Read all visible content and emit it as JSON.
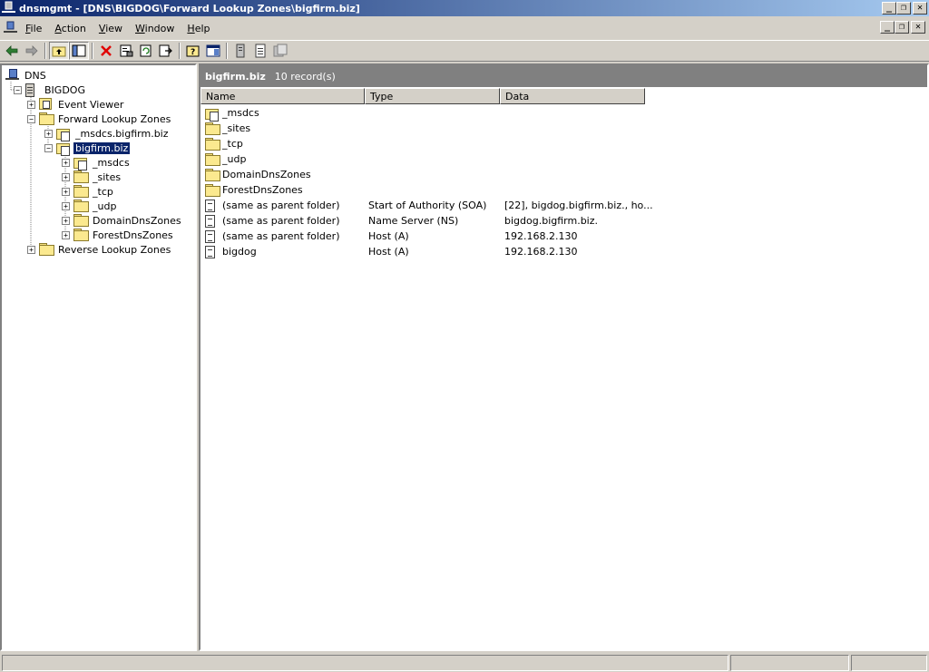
{
  "window": {
    "title": "dnsmgmt - [DNS\\BIGDOG\\Forward Lookup Zones\\bigfirm.biz]",
    "controls": {
      "minimize": "_",
      "restore": "❐",
      "close": "✕"
    }
  },
  "menu": {
    "items": [
      {
        "label": "File",
        "key": "F",
        "rest": "ile"
      },
      {
        "label": "Action",
        "key": "A",
        "rest": "ction"
      },
      {
        "label": "View",
        "key": "V",
        "rest": "iew"
      },
      {
        "label": "Window",
        "key": "W",
        "rest": "indow"
      },
      {
        "label": "Help",
        "key": "H",
        "rest": "elp"
      }
    ]
  },
  "toolbar": {
    "icons": [
      "back-icon",
      "forward-icon",
      "up-icon",
      "show-hide-tree-icon",
      "delete-icon",
      "properties-icon",
      "refresh-icon",
      "export-icon",
      "help-icon",
      "action-pane-icon",
      "server-icon",
      "record-icon",
      "zone-icon"
    ]
  },
  "tree": {
    "items": [
      {
        "label": "DNS",
        "icon": "dns-icon",
        "expander": "",
        "level": 0
      },
      {
        "label": "BIGDOG",
        "icon": "server-icon",
        "expander": "−",
        "level": 1
      },
      {
        "label": "Event Viewer",
        "icon": "event-viewer-icon",
        "expander": "+",
        "level": 2
      },
      {
        "label": "Forward Lookup Zones",
        "icon": "folder-icon",
        "expander": "−",
        "level": 2
      },
      {
        "label": "_msdcs.bigfirm.biz",
        "icon": "zone-icon",
        "expander": "+",
        "level": 3
      },
      {
        "label": "bigfirm.biz",
        "icon": "zone-icon",
        "expander": "−",
        "level": 3,
        "selected": true
      },
      {
        "label": "_msdcs",
        "icon": "zone-icon",
        "expander": "+",
        "level": 4
      },
      {
        "label": "_sites",
        "icon": "folder-icon",
        "expander": "+",
        "level": 4
      },
      {
        "label": "_tcp",
        "icon": "folder-icon",
        "expander": "+",
        "level": 4
      },
      {
        "label": "_udp",
        "icon": "folder-icon",
        "expander": "+",
        "level": 4
      },
      {
        "label": "DomainDnsZones",
        "icon": "folder-icon",
        "expander": "+",
        "level": 4
      },
      {
        "label": "ForestDnsZones",
        "icon": "folder-icon",
        "expander": "+",
        "level": 4
      },
      {
        "label": "Reverse Lookup Zones",
        "icon": "folder-icon",
        "expander": "+",
        "level": 2
      }
    ]
  },
  "list": {
    "zone": "bigfirm.biz",
    "count": "10 record(s)",
    "columns": [
      "Name",
      "Type",
      "Data"
    ],
    "rows": [
      {
        "icon": "zone-icon",
        "name": "_msdcs",
        "type": "",
        "data": ""
      },
      {
        "icon": "folder-icon",
        "name": "_sites",
        "type": "",
        "data": ""
      },
      {
        "icon": "folder-icon",
        "name": "_tcp",
        "type": "",
        "data": ""
      },
      {
        "icon": "folder-icon",
        "name": "_udp",
        "type": "",
        "data": ""
      },
      {
        "icon": "folder-icon",
        "name": "DomainDnsZones",
        "type": "",
        "data": ""
      },
      {
        "icon": "folder-icon",
        "name": "ForestDnsZones",
        "type": "",
        "data": ""
      },
      {
        "icon": "record-icon",
        "name": "(same as parent folder)",
        "type": "Start of Authority (SOA)",
        "data": "[22], bigdog.bigfirm.biz., ho..."
      },
      {
        "icon": "record-icon",
        "name": "(same as parent folder)",
        "type": "Name Server (NS)",
        "data": "bigdog.bigfirm.biz."
      },
      {
        "icon": "record-icon",
        "name": "(same as parent folder)",
        "type": "Host (A)",
        "data": "192.168.2.130"
      },
      {
        "icon": "record-icon",
        "name": "bigdog",
        "type": "Host (A)",
        "data": "192.168.2.130"
      }
    ]
  }
}
